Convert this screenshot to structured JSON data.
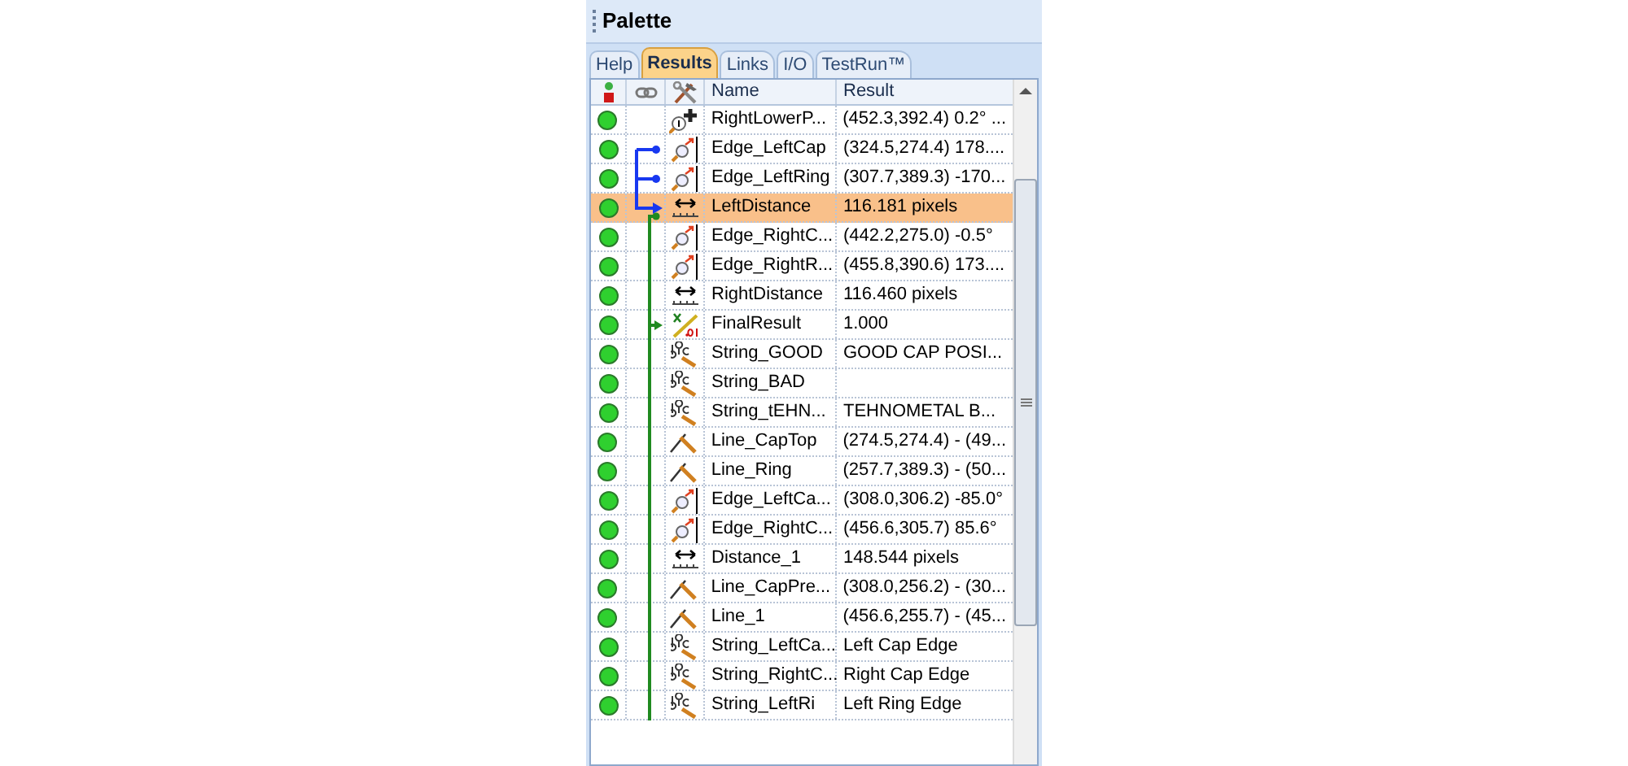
{
  "panel": {
    "title": "Palette"
  },
  "tabs": [
    {
      "label": "Help",
      "selected": false
    },
    {
      "label": "Results",
      "selected": true
    },
    {
      "label": "Links",
      "selected": false
    },
    {
      "label": "I/O",
      "selected": false
    },
    {
      "label": "TestRun™",
      "selected": false
    }
  ],
  "table": {
    "columns": [
      "Name",
      "Result"
    ],
    "rows": [
      {
        "passed": true,
        "kind": "point",
        "name": "RightLowerP...",
        "result": "(452.3,392.4) 0.2° ...",
        "selected": false
      },
      {
        "passed": true,
        "kind": "edge",
        "name": "Edge_LeftCap",
        "result": "(324.5,274.4) 178....",
        "selected": false
      },
      {
        "passed": true,
        "kind": "edge",
        "name": "Edge_LeftRing",
        "result": "(307.7,389.3) -170...",
        "selected": false
      },
      {
        "passed": true,
        "kind": "distance",
        "name": "LeftDistance",
        "result": "116.181 pixels",
        "selected": true
      },
      {
        "passed": true,
        "kind": "edge",
        "name": "Edge_RightC...",
        "result": "(442.2,275.0) -0.5°",
        "selected": false
      },
      {
        "passed": true,
        "kind": "edge",
        "name": "Edge_RightR...",
        "result": "(455.8,390.6) 173....",
        "selected": false
      },
      {
        "passed": true,
        "kind": "distance",
        "name": "RightDistance",
        "result": "116.460 pixels",
        "selected": false
      },
      {
        "passed": true,
        "kind": "calc",
        "name": "FinalResult",
        "result": "1.000",
        "selected": false
      },
      {
        "passed": true,
        "kind": "string",
        "name": "String_GOOD",
        "result": "GOOD CAP POSI...",
        "selected": false
      },
      {
        "passed": true,
        "kind": "string",
        "name": "String_BAD",
        "selected": false
      },
      {
        "passed": true,
        "kind": "string",
        "name": "String_tEHN...",
        "result": "TEHNOMETAL B...",
        "selected": false
      },
      {
        "passed": true,
        "kind": "line",
        "name": "Line_CapTop",
        "result": "(274.5,274.4) - (49...",
        "selected": false
      },
      {
        "passed": true,
        "kind": "line",
        "name": "Line_Ring",
        "result": "(257.7,389.3) - (50...",
        "selected": false
      },
      {
        "passed": true,
        "kind": "edge",
        "name": "Edge_LeftCa...",
        "result": "(308.0,306.2) -85.0°",
        "selected": false
      },
      {
        "passed": true,
        "kind": "edge",
        "name": "Edge_RightC...",
        "result": "(456.6,305.7) 85.6°",
        "selected": false
      },
      {
        "passed": true,
        "kind": "distance",
        "name": "Distance_1",
        "result": "148.544 pixels",
        "selected": false
      },
      {
        "passed": true,
        "kind": "line",
        "name": "Line_CapPre...",
        "result": "(308.0,256.2) - (30...",
        "selected": false
      },
      {
        "passed": true,
        "kind": "line",
        "name": "Line_1",
        "result": "(456.6,255.7) - (45...",
        "selected": false
      },
      {
        "passed": true,
        "kind": "string",
        "name": "String_LeftCa...",
        "result": "Left Cap Edge",
        "selected": false
      },
      {
        "passed": true,
        "kind": "string",
        "name": "String_RightC...",
        "result": "Right Cap Edge",
        "selected": false
      },
      {
        "passed": true,
        "kind": "string",
        "name": "String_LeftRi",
        "result": "Left Ring Edge",
        "selected": false
      }
    ]
  }
}
